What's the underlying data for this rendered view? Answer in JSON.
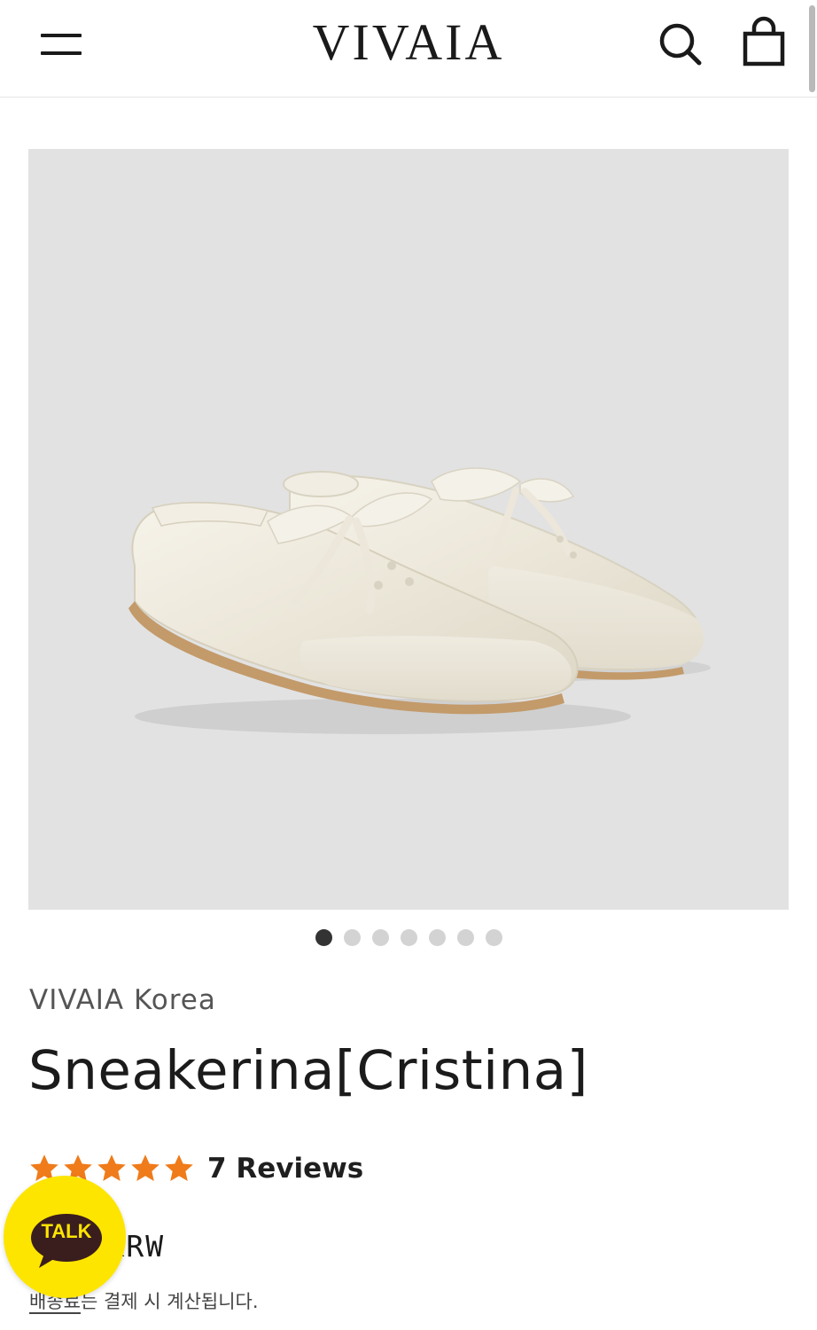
{
  "header": {
    "logo": "VIVAIA",
    "icons": [
      "hamburger-menu-icon",
      "search-icon",
      "shopping-bag-icon"
    ]
  },
  "gallery": {
    "image_count": 7,
    "active_index": 0
  },
  "product": {
    "brand": "VIVAIA Korea",
    "title": "Sneakerina[Cristina]",
    "rating": 5,
    "rating_max": 5,
    "reviews_label": "7 Reviews",
    "price_visible": "000 KRW",
    "shipping_link": "배송료",
    "shipping_text": "는 결제 시 계산됩니다."
  },
  "chat": {
    "label": "TALK"
  },
  "colors": {
    "star": "#ef7b1a",
    "kakao_yellow": "#fde500",
    "kakao_brown": "#3a1d1d",
    "image_bg": "#e2e2e2",
    "dot_active": "#333333",
    "dot_inactive": "#d3d3d3"
  }
}
